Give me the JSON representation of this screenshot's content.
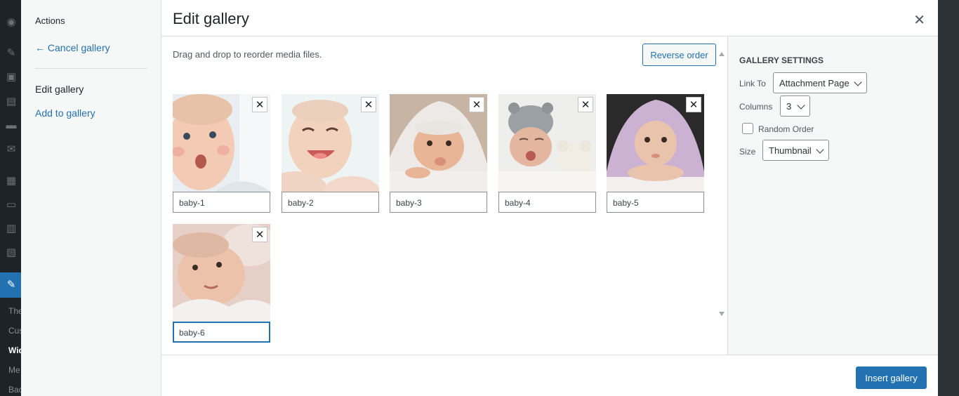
{
  "admin_menu": {
    "partial_labels": [
      "The",
      "Cus",
      "Wid",
      "Me",
      "Bac"
    ]
  },
  "media_menu": {
    "heading": "Actions",
    "cancel_link": "← Cancel gallery",
    "edit_gallery": "Edit gallery",
    "add_to_gallery": "Add to gallery"
  },
  "frame": {
    "title": "Edit gallery",
    "close_icon": "close-icon"
  },
  "content": {
    "instructions": "Drag and drop to reorder media files.",
    "reverse_order_label": "Reverse order"
  },
  "gallery_items": [
    {
      "caption": "baby-1"
    },
    {
      "caption": "baby-2"
    },
    {
      "caption": "baby-3"
    },
    {
      "caption": "baby-4"
    },
    {
      "caption": "baby-5"
    },
    {
      "caption": "baby-6"
    }
  ],
  "settings": {
    "heading": "Gallery Settings",
    "link_to_label": "Link To",
    "link_to_value": "Attachment Page",
    "columns_label": "Columns",
    "columns_value": "3",
    "random_order_label": "Random Order",
    "random_order_checked": false,
    "size_label": "Size",
    "size_value": "Thumbnail"
  },
  "toolbar": {
    "insert_label": "Insert gallery"
  },
  "colors": {
    "accent": "#2271b1",
    "admin_bg": "#1d2327",
    "sidebar_bg": "#f6f7f7"
  }
}
